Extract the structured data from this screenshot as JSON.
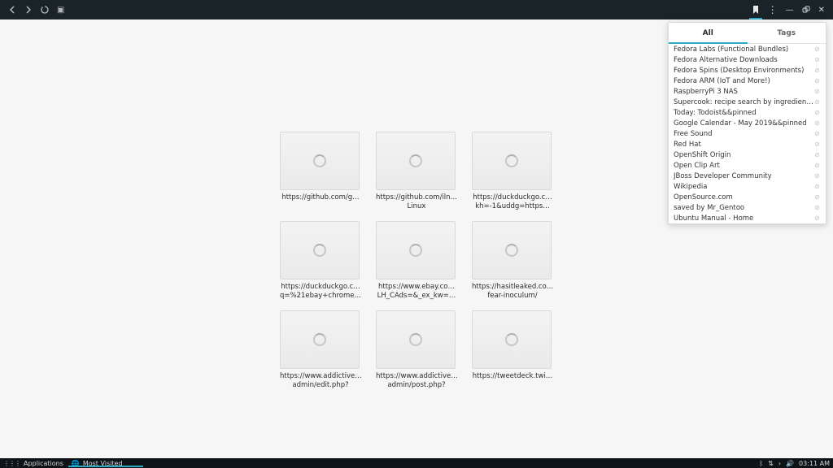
{
  "topbar": {
    "icons": {
      "back": "←",
      "forward": "→",
      "reload": "⟳",
      "user": "◫"
    },
    "right": {
      "bookmarks": "◆",
      "menu": "⋮",
      "min": "—",
      "link": "🔗",
      "close": "✕"
    }
  },
  "tiles": [
    {
      "line1": "https://github.com/g…",
      "line2": ""
    },
    {
      "line1": "https://github.com/iln…",
      "line2": "Linux"
    },
    {
      "line1": "https://duckduckgo.c…",
      "line2": "kh=-1&uddg=https…"
    },
    {
      "line1": "https://duckduckgo.c…",
      "line2": "q=%21ebay+chrome…"
    },
    {
      "line1": "https://www.ebay.co…",
      "line2": "LH_CAds=&_ex_kw=…"
    },
    {
      "line1": "https://hasitleaked.co…",
      "line2": "fear-inoculum/"
    },
    {
      "line1": "https://www.addictive…",
      "line2": "admin/edit.php?"
    },
    {
      "line1": "https://www.addictive…",
      "line2": "admin/post.php?"
    },
    {
      "line1": "https://tweetdeck.twi…",
      "line2": ""
    }
  ],
  "panel": {
    "tabs": {
      "all": "All",
      "tags": "Tags"
    },
    "items": [
      "Fedora Labs (Functional Bundles)",
      "Fedora Alternative Downloads",
      "Fedora Spins (Desktop Environments)",
      "Fedora ARM (IoT and More!)",
      "RaspberryPi 3 NAS",
      "Supercook: recipe search by ingredients …",
      "Today: Todoist&&pinned",
      "Google Calendar - May 2019&&pinned",
      "Free Sound",
      "Red Hat",
      "OpenShift Origin",
      "Open Clip Art",
      "JBoss Developer Community",
      "Wikipedia",
      "OpenSource.com",
      "saved by Mr_Gentoo",
      "Ubuntu Manual - Home"
    ]
  },
  "taskbar": {
    "applications": "Applications",
    "mostvisited": "Most Visited",
    "clock": "03:11 AM",
    "tray": {
      "bt": "ᛒ",
      "net": "⇅",
      "chev": "›",
      "vol": "🔊"
    }
  }
}
